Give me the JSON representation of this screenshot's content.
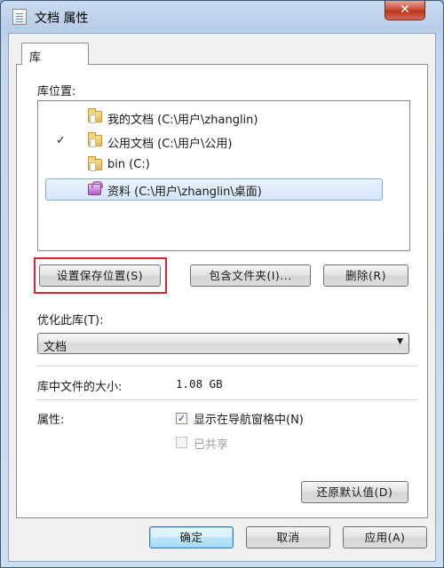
{
  "window": {
    "title": "文档 属性",
    "close_label": "✕"
  },
  "tab": {
    "label": "库"
  },
  "library_locations": {
    "label": "库位置:",
    "items": [
      {
        "text": "我的文档 (C:\\用户\\zhanglin)",
        "checked": false,
        "icon": "folder-icon",
        "selected": false
      },
      {
        "text": "公用文档 (C:\\用户\\公用)",
        "checked": true,
        "icon": "folder-icon",
        "selected": false
      },
      {
        "text": "bin (C:)",
        "checked": false,
        "icon": "folder-icon",
        "selected": false
      },
      {
        "text": "资料 (C:\\用户\\zhanglin\\桌面)",
        "checked": false,
        "icon": "library-icon",
        "selected": true
      }
    ],
    "check_glyph": "✓"
  },
  "buttons": {
    "set_save_location": "设置保存位置(S)",
    "include_folder": "包含文件夹(I)...",
    "remove": "删除(R)",
    "restore_defaults": "还原默认值(D)",
    "ok": "确定",
    "cancel": "取消",
    "apply": "应用(A)"
  },
  "optimize": {
    "label": "优化此库(T):",
    "selected": "文档",
    "arrow": "▼"
  },
  "size": {
    "label": "库中文件的大小:",
    "value": "1.08 GB"
  },
  "attributes": {
    "label": "属性:",
    "show_in_nav": {
      "label": "显示在导航窗格中(N)",
      "checked": true,
      "glyph": "✓"
    },
    "shared": {
      "label": "已共享",
      "checked": false,
      "disabled": true
    }
  },
  "highlight_color": "#d7262f"
}
